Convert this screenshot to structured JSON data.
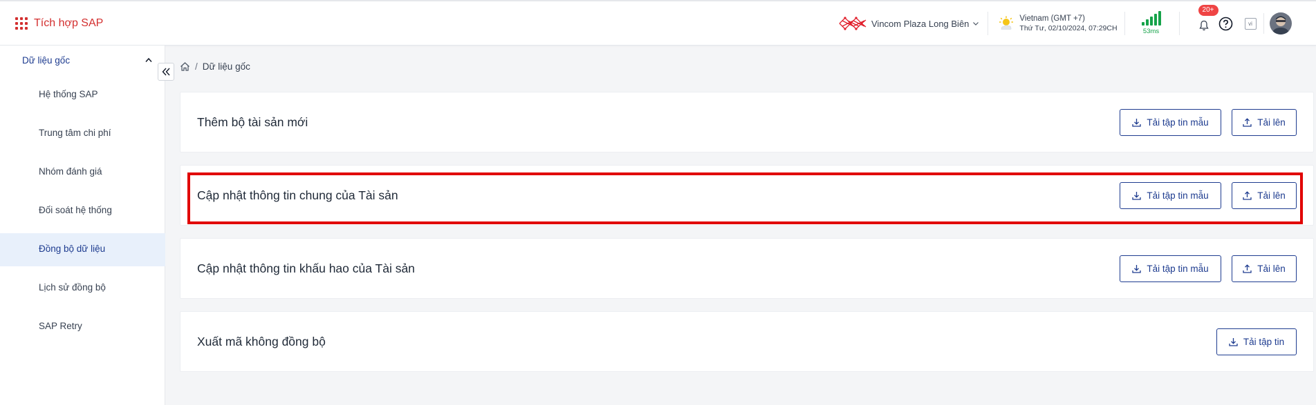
{
  "header": {
    "app_title": "Tích hợp SAP",
    "location": "Vincom Plaza Long Biên",
    "timezone": "Vietnam (GMT +7)",
    "datetime": "Thứ Tư, 02/10/2024, 07:29CH",
    "ping": "53ms",
    "notification_badge": "20+",
    "language": "vi"
  },
  "sidebar": {
    "group_label": "Dữ liệu gốc",
    "items": [
      {
        "label": "Hệ thống SAP"
      },
      {
        "label": "Trung tâm chi phí"
      },
      {
        "label": "Nhóm đánh giá"
      },
      {
        "label": "Đối soát hệ thống"
      },
      {
        "label": "Đồng bộ dữ liệu"
      },
      {
        "label": "Lịch sử đồng bộ"
      },
      {
        "label": "SAP Retry"
      }
    ]
  },
  "breadcrumb": {
    "current": "Dữ liệu gốc"
  },
  "cards": [
    {
      "title": "Thêm bộ tài sản mới",
      "template_label": "Tải tập tin mẫu",
      "upload_label": "Tải lên"
    },
    {
      "title": "Cập nhật thông tin chung của Tài sản",
      "template_label": "Tải tập tin mẫu",
      "upload_label": "Tải lên"
    },
    {
      "title": "Cập nhật thông tin khấu hao của Tài sản",
      "template_label": "Tải tập tin mẫu",
      "upload_label": "Tải lên"
    },
    {
      "title": "Xuất mã không đồng bộ",
      "download_label": "Tải tập tin"
    }
  ],
  "colors": {
    "brand": "#d32f2f",
    "primary": "#1d3b8f",
    "active_bg": "#e8f0fb",
    "signal": "#16a34a",
    "highlight": "#e10000"
  }
}
